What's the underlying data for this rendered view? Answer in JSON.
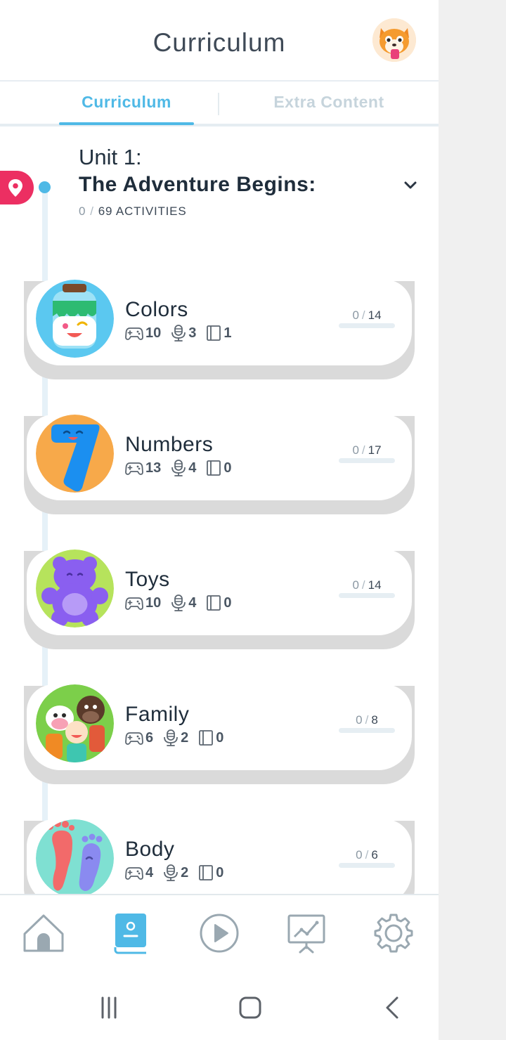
{
  "header": {
    "title": "Curriculum"
  },
  "tabs": [
    {
      "label": "Curriculum",
      "active": true
    },
    {
      "label": "Extra Content",
      "active": false
    }
  ],
  "unit": {
    "label": "Unit 1:",
    "name": "The Adventure Begins:",
    "progress_done": "0",
    "progress_total": "69 ACTIVITIES"
  },
  "lessons": [
    {
      "title": "Colors",
      "games": "10",
      "speaking": "3",
      "reading": "1",
      "done": "0",
      "total": "14",
      "progress": 0
    },
    {
      "title": "Numbers",
      "games": "13",
      "speaking": "4",
      "reading": "0",
      "done": "0",
      "total": "17",
      "progress": 0
    },
    {
      "title": "Toys",
      "games": "10",
      "speaking": "4",
      "reading": "0",
      "done": "0",
      "total": "14",
      "progress": 0
    },
    {
      "title": "Family",
      "games": "6",
      "speaking": "2",
      "reading": "0",
      "done": "0",
      "total": "8",
      "progress": 0
    },
    {
      "title": "Body",
      "games": "4",
      "speaking": "2",
      "reading": "0",
      "done": "0",
      "total": "6",
      "progress": 0
    }
  ],
  "bottom_nav": [
    {
      "icon": "home-icon",
      "active": false
    },
    {
      "icon": "curriculum-book-icon",
      "active": true
    },
    {
      "icon": "play-icon",
      "active": false
    },
    {
      "icon": "progress-chart-icon",
      "active": false
    },
    {
      "icon": "settings-gear-icon",
      "active": false
    }
  ],
  "colors": {
    "accent": "#4fb9e6",
    "pin": "#ec2f62",
    "text_dark": "#1f2d3b",
    "tab_inactive": "#c6d4dc"
  }
}
